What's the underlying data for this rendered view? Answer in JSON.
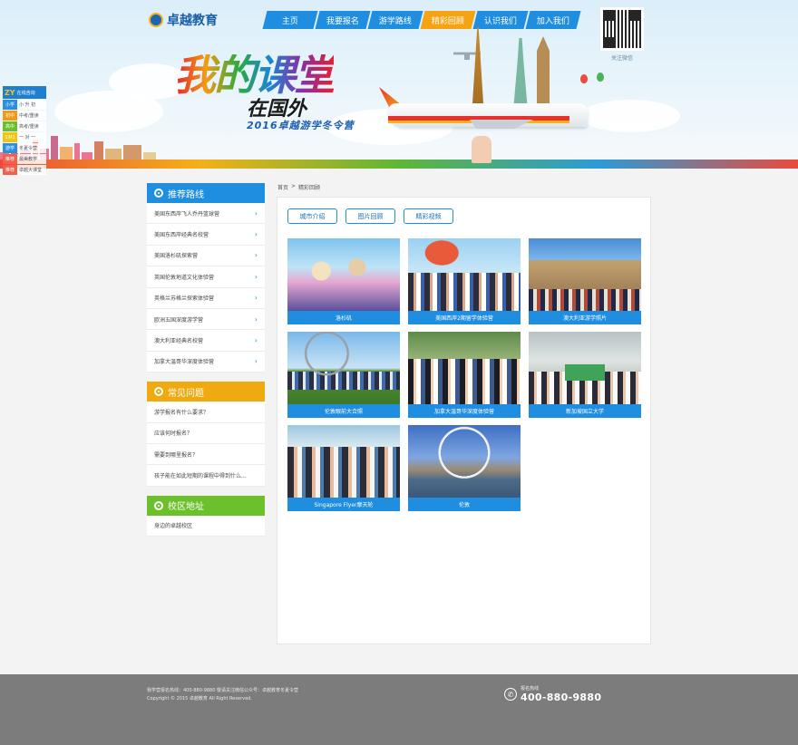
{
  "header": {
    "logo_text": "卓越教育",
    "nav": [
      {
        "label": "主页",
        "active": false
      },
      {
        "label": "我要报名",
        "active": false
      },
      {
        "label": "游学路线",
        "active": false
      },
      {
        "label": "精彩回顾",
        "active": true
      },
      {
        "label": "认识我们",
        "active": false
      },
      {
        "label": "加入我们",
        "active": false
      }
    ],
    "qr_label": "关注微信"
  },
  "banner": {
    "slogan_main": "我的课堂",
    "slogan_sub": "在国外",
    "camp_title": "2016卓越游学冬令营"
  },
  "online_service": {
    "title_mark": "ZY",
    "title": "在线咨询",
    "rows": [
      {
        "tag": "小学",
        "text": "小 升 初",
        "color": "#2b8fe0"
      },
      {
        "tag": "初中",
        "text": "中考/重读",
        "color": "#f19a13"
      },
      {
        "tag": "高中",
        "text": "高考/重读",
        "color": "#6bbf2b"
      },
      {
        "tag": "1对1",
        "text": "一 对 一",
        "color": "#f2c412"
      },
      {
        "tag": "游学",
        "text": "冬夏令营",
        "color": "#2b8fe0"
      },
      {
        "tag": "推荐",
        "text": "最美教学",
        "color": "#f0604a"
      },
      {
        "tag": "推荐",
        "text": "卓越大课堂",
        "color": "#f0604a"
      }
    ]
  },
  "sidebar": {
    "routes": {
      "title": "推荐路线",
      "items": [
        "美国东西岸飞人乔丹篮球营",
        "美国东西岸经典名校营",
        "美国洛杉矶探索营",
        "英国伦敦地道文化体验营",
        "英格兰苏格兰探索体验营",
        "欧洲五国深度游学营",
        "澳大利亚经典名校营",
        "加拿大温哥华深度体验营"
      ]
    },
    "faq": {
      "title": "常见问题",
      "items": [
        "游学报名有什么要求？",
        "应该何时报名？",
        "需要到哪里报名？",
        "孩子能在如此短期的课程中得到什么..."
      ]
    },
    "campus": {
      "title": "校区地址",
      "items": [
        "身边的卓越校区"
      ]
    }
  },
  "breadcrumb": {
    "home": "首页",
    "sep": ">",
    "current": "精彩回顾"
  },
  "tabs": [
    "城市介绍",
    "图片回顾",
    "精彩视频"
  ],
  "gallery": [
    {
      "caption": "洛杉矶",
      "scene": "disney"
    },
    {
      "caption": "美国西岸2期留学体验营",
      "scene": "group-park"
    },
    {
      "caption": "澳大利亚游学照片",
      "scene": "university"
    },
    {
      "caption": "伦敦眼前大合照",
      "scene": "london-eye-group"
    },
    {
      "caption": "加拿大温哥华深度体验营",
      "scene": "street-group"
    },
    {
      "caption": "新加坡国立大学",
      "scene": "banner-group"
    },
    {
      "caption": "Singapore Flyer摩天轮",
      "scene": "flyer-inside"
    },
    {
      "caption": "伦敦",
      "scene": "london-eye"
    }
  ],
  "footer": {
    "line1": "我学营报名热线：400-880-9880  敬请关注微信公众号：卓越教育冬夏令营",
    "line2": "Copyright © 2015 卓越教育 All Right Reserved.",
    "hotline_label": "报名热线",
    "hotline_number": "400-880-9880"
  }
}
